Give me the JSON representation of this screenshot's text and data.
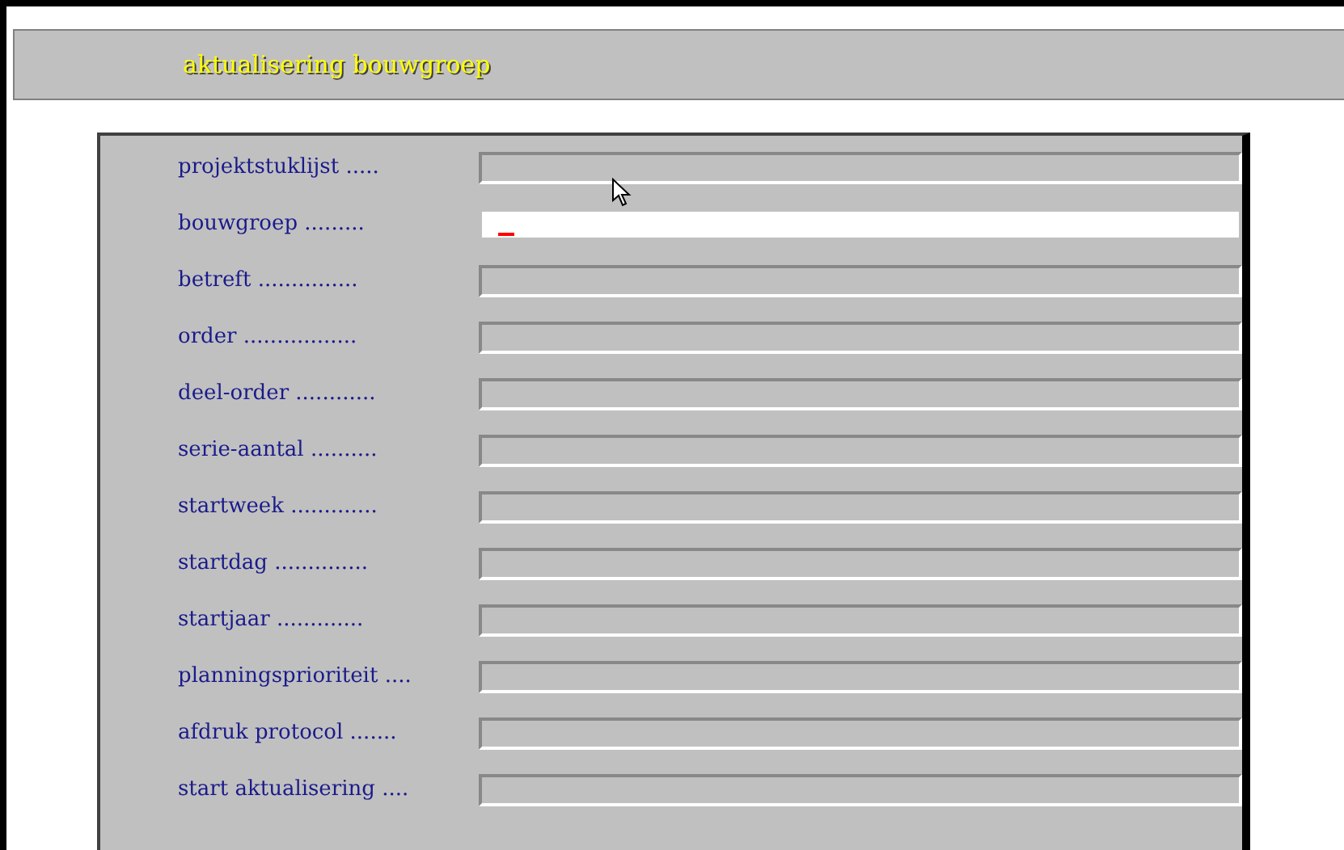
{
  "header": {
    "title": "aktualisering bouwgroep"
  },
  "fields": [
    {
      "label": "projektstuklijst .....",
      "focused": false
    },
    {
      "label": "bouwgroep .........",
      "focused": true
    },
    {
      "label": "betreft ...............",
      "focused": false
    },
    {
      "label": "order .................",
      "focused": false
    },
    {
      "label": "deel-order ............",
      "focused": false
    },
    {
      "label": "serie-aantal ..........",
      "focused": false
    },
    {
      "label": "startweek .............",
      "focused": false
    },
    {
      "label": "startdag ..............",
      "focused": false
    },
    {
      "label": "startjaar .............",
      "focused": false
    },
    {
      "label": "planningsprioriteit ....",
      "focused": false
    },
    {
      "label": "afdruk protocol .......",
      "focused": false
    },
    {
      "label": "start aktualisering ....",
      "focused": false
    }
  ]
}
